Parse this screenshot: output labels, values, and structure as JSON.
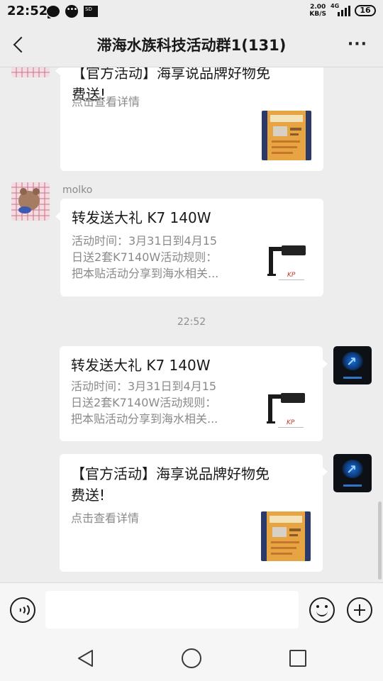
{
  "status_bar": {
    "time": "22:52",
    "sd_label": "SD",
    "net_speed_value": "2.00",
    "net_speed_unit": "KB/S",
    "network": "4G",
    "battery": "16"
  },
  "header": {
    "title": "滞海水族科技活动群1(131)",
    "more_label": "···"
  },
  "messages": {
    "msg1": {
      "title_line1": "【官方活动】海享说品牌好物免",
      "title_line2": "费送!",
      "desc": "点击查看详情"
    },
    "msg2": {
      "sender": "molko",
      "title": "转发送大礼 K7 140W",
      "desc_line1": "活动时间：3月31日到4月15",
      "desc_line2": "日送2套K7140W活动规则：",
      "desc_line3": "把本贴活动分享到海水相关..."
    },
    "timestamp": "22:52",
    "msg3": {
      "title": "转发送大礼 K7 140W",
      "desc_line1": "活动时间：3月31日到4月15",
      "desc_line2": "日送2套K7140W活动规则：",
      "desc_line3": "把本贴活动分享到海水相关..."
    },
    "msg4": {
      "title_line1": "【官方活动】海享说品牌好物免",
      "title_line2": "费送!",
      "desc": "点击查看详情"
    }
  },
  "input_bar": {
    "placeholder": ""
  }
}
